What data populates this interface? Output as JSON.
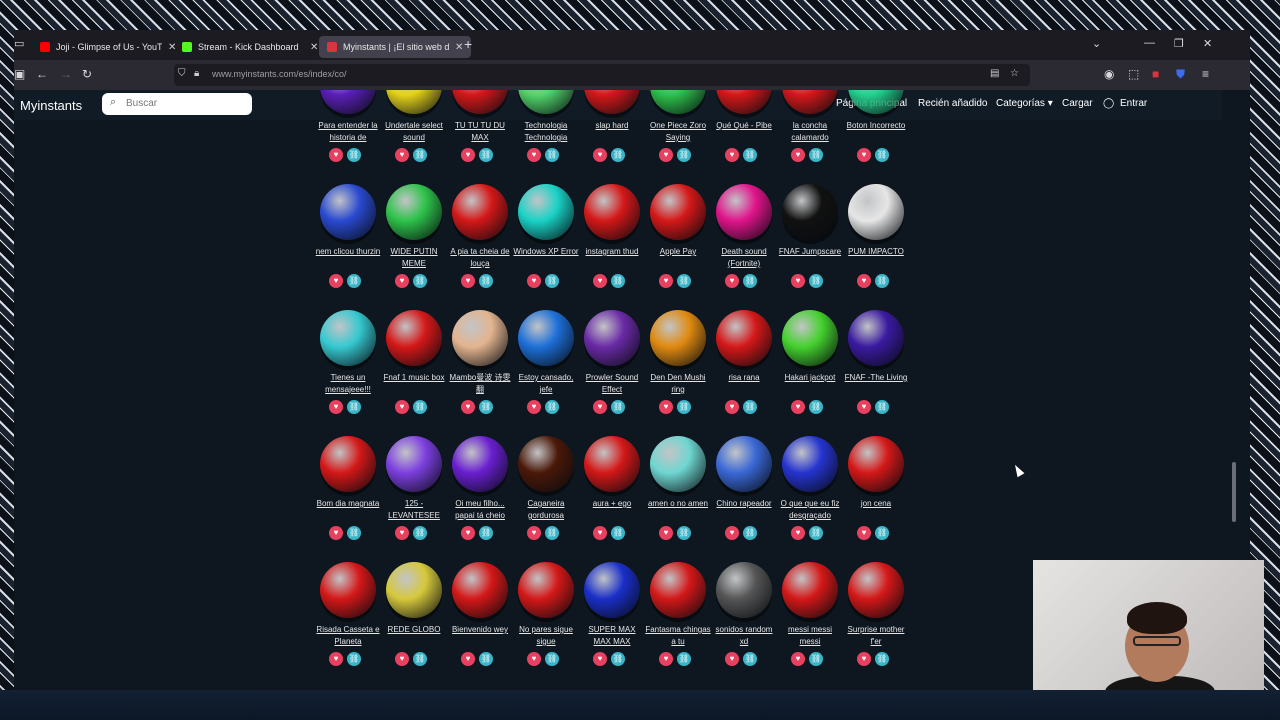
{
  "browser": {
    "tabs": [
      {
        "label": "Joji - Glimpse of Us - YouTube",
        "color": "#ff0000",
        "active": false
      },
      {
        "label": "Stream - Kick Dashboard",
        "color": "#53fc18",
        "active": false
      },
      {
        "label": "Myinstants | ¡El sitio web d",
        "color": "#e0323c",
        "active": true
      }
    ],
    "new_tab": "+",
    "url": "www.myinstants.com/es/index/co/"
  },
  "site": {
    "brand": "Myinstants",
    "search_placeholder": "Buscar",
    "nav": [
      "Página principal",
      "Recién añadido",
      "Categorías ▾",
      "Cargar",
      "Entrar"
    ]
  },
  "sounds": [
    {
      "label": "Para entender la historia de",
      "color": "#5b1fb5"
    },
    {
      "label": "Undertale select sound",
      "color": "#e6d21c"
    },
    {
      "label": "TU TU TU DU MAX",
      "color": "#d41818"
    },
    {
      "label": "Technologia Technologia",
      "color": "#52d66a"
    },
    {
      "label": "slap hard",
      "color": "#d41818"
    },
    {
      "label": "One Piece Zoro Saying",
      "color": "#2ec24a"
    },
    {
      "label": "Qué Qué - Pibe",
      "color": "#d41818"
    },
    {
      "label": "la concha calamardo",
      "color": "#d41818"
    },
    {
      "label": "Boton Incorrecto",
      "color": "#26d08e"
    },
    {
      "label": "nem clicou thurzin",
      "color": "#2a4ad1"
    },
    {
      "label": "WIDE PUTIN MEME",
      "color": "#2ec24a"
    },
    {
      "label": "A pia ta cheia de louça",
      "color": "#d41818"
    },
    {
      "label": "Windows XP Error",
      "color": "#19d2c6"
    },
    {
      "label": "instagram thud",
      "color": "#d41818"
    },
    {
      "label": "Apple Pay",
      "color": "#d41818"
    },
    {
      "label": "Death sound (Fortnite)",
      "color": "#e0148a"
    },
    {
      "label": "FNAF Jumpscare",
      "color": "#111111"
    },
    {
      "label": "PUM IMPACTO",
      "color": "#e6e6e6"
    },
    {
      "label": "Tienes un mensajeee!!!",
      "color": "#36c9d0"
    },
    {
      "label": "Fnaf 1 music box",
      "color": "#d41818"
    },
    {
      "label": "Mambo曼波 诗雯翻",
      "color": "#e3b48f"
    },
    {
      "label": "Estoy cansado, jefe",
      "color": "#1d6fd8"
    },
    {
      "label": "Prowler Sound Effect",
      "color": "#6a2aa6"
    },
    {
      "label": "Den Den Mushi ring",
      "color": "#e08a10"
    },
    {
      "label": "risa rana",
      "color": "#d41818"
    },
    {
      "label": "Hakari jackpot",
      "color": "#45d12e"
    },
    {
      "label": "FNAF -The Living",
      "color": "#3a1aa0"
    },
    {
      "label": "Bom dia magnata",
      "color": "#d41818"
    },
    {
      "label": "125 - LEVANTESEE",
      "color": "#7d3fe0"
    },
    {
      "label": "Oi meu filho... papai tá cheio",
      "color": "#6a1fd0"
    },
    {
      "label": "Caganeira gordurosa",
      "color": "#4a1808"
    },
    {
      "label": "aura + ego",
      "color": "#d41818"
    },
    {
      "label": "amen o no amen",
      "color": "#6fd6d0"
    },
    {
      "label": "Chino rapeador",
      "color": "#3a68d6"
    },
    {
      "label": "O que que eu fiz desgraçado",
      "color": "#2634d0"
    },
    {
      "label": "jon cena",
      "color": "#d41818"
    },
    {
      "label": "Risada Casseta e Planeta",
      "color": "#d41818"
    },
    {
      "label": "REDE GLOBO",
      "color": "#d6c83c"
    },
    {
      "label": "Bienvenido wey",
      "color": "#d41818"
    },
    {
      "label": "No pares sigue sigue",
      "color": "#d41818"
    },
    {
      "label": "SUPER MAX MAX MAX",
      "color": "#1a2fc8"
    },
    {
      "label": "Fantasma chingas a tu",
      "color": "#d41818"
    },
    {
      "label": "sonidos random xd",
      "color": "#555555"
    },
    {
      "label": "messi messi messi",
      "color": "#d41818"
    },
    {
      "label": "Surprise mother f'er",
      "color": "#d41818"
    }
  ],
  "favorite_icon": "heart-icon",
  "share_icon": "link-icon"
}
